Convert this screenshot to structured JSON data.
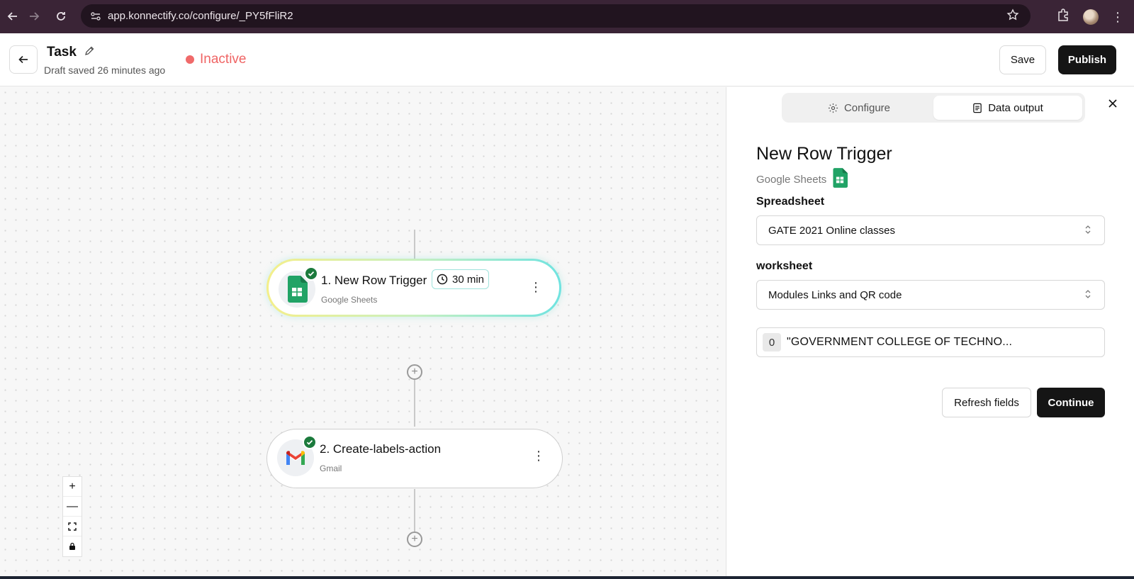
{
  "browser": {
    "url": "app.konnectify.co/configure/_PY5fFliR2",
    "icons": [
      "back-arrow-icon",
      "forward-arrow-icon",
      "reload-icon",
      "site-settings-icon",
      "star-icon",
      "extensions-icon",
      "profile-avatar",
      "more-vert-icon"
    ]
  },
  "header": {
    "title": "Task",
    "draft_status": "Draft saved 26 minutes ago",
    "status_label": "Inactive",
    "status_color": "#ef6464",
    "save_label": "Save",
    "publish_label": "Publish"
  },
  "workflow": {
    "nodes": [
      {
        "title": "1. New Row Trigger",
        "app": "Google Sheets",
        "timer": "30 min",
        "icon": "google-sheets-icon",
        "status_icon": "check-icon"
      },
      {
        "title": "2. Create-labels-action",
        "app": "Gmail",
        "icon": "gmail-icon",
        "status_icon": "check-icon"
      }
    ],
    "zoom_controls": {
      "zoom_in": "+",
      "zoom_out": "—"
    }
  },
  "panel": {
    "tabs": [
      {
        "label": "Configure",
        "icon": "gear-icon",
        "active": false
      },
      {
        "label": "Data output",
        "icon": "document-icon",
        "active": true
      }
    ],
    "title": "New Row Trigger",
    "app_name": "Google Sheets",
    "spreadsheet_label": "Spreadsheet",
    "spreadsheet_value": "GATE 2021 Online classes",
    "worksheet_label": "worksheet",
    "worksheet_value": "Modules Links and QR code",
    "output_index": "0",
    "output_value": "\"GOVERNMENT COLLEGE OF TECHNO...",
    "refresh_label": "Refresh fields",
    "continue_label": "Continue"
  },
  "colors": {
    "accent_dark": "#151515",
    "success_green": "#1b7a3c",
    "sheets_green": "#21a366"
  }
}
